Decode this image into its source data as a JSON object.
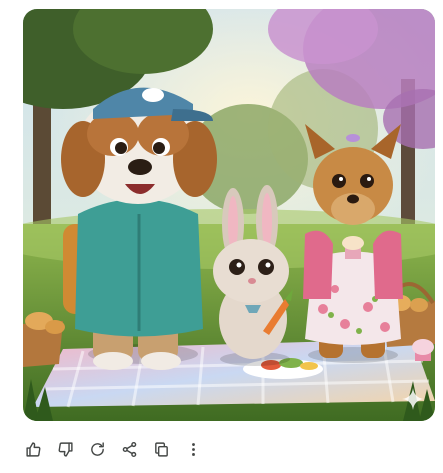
{
  "generated_image": {
    "alt": "",
    "badge_icon": "sparkle-icon"
  },
  "toolbar": {
    "actions": [
      {
        "icon": "thumbs-up-icon"
      },
      {
        "icon": "thumbs-down-icon"
      },
      {
        "icon": "regenerate-icon"
      },
      {
        "icon": "share-icon"
      },
      {
        "icon": "copy-icon"
      },
      {
        "icon": "more-options-icon"
      }
    ],
    "icon_color": "#444746"
  }
}
